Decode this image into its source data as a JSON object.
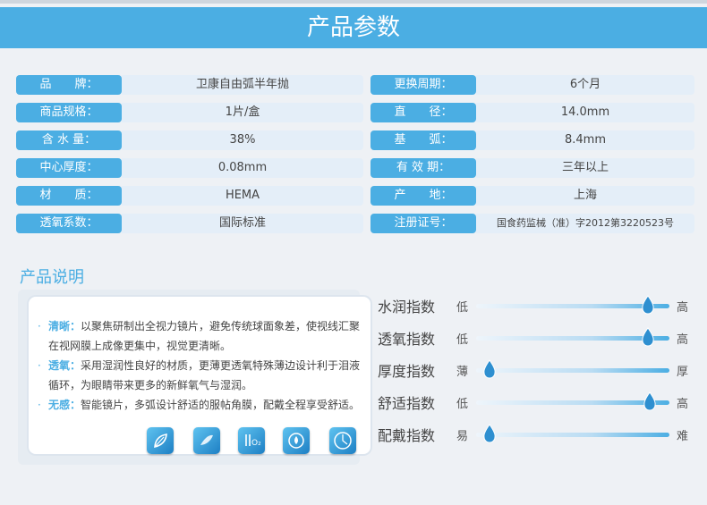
{
  "banner": {
    "title": "产品参数"
  },
  "params": [
    {
      "l_label": "品　　牌：",
      "l_value": "卫康自由弧半年抛",
      "r_label": "更换周期：",
      "r_value": "6个月"
    },
    {
      "l_label": "商品规格：",
      "l_value": "1片/盒",
      "r_label": "直　　径：",
      "r_value": "14.0mm"
    },
    {
      "l_label": "含 水 量：",
      "l_value": "38%",
      "r_label": "基　　弧：",
      "r_value": "8.4mm"
    },
    {
      "l_label": "中心厚度：",
      "l_value": "0.08mm",
      "r_label": "有 效 期：",
      "r_value": "三年以上"
    },
    {
      "l_label": "材　　质：",
      "l_value": "HEMA",
      "r_label": "产　　地：",
      "r_value": "上海"
    },
    {
      "l_label": "透氧系数：",
      "l_value": "国际标准",
      "r_label": "注册证号：",
      "r_value": "国食药监械（准）字2012第3220523号"
    }
  ],
  "description": {
    "title": "产品说明",
    "items": [
      {
        "bullet": "·",
        "head": "清晰：",
        "text": "以聚焦研制出全视力镜片，避免传统球面象差，使视线汇聚在视网膜上成像更集中，视觉更清晰。"
      },
      {
        "bullet": "·",
        "head": "透氧：",
        "text": "采用湿润性良好的材质，更薄更透氧特殊薄边设计利于泪液循环，为眼睛带来更多的新鲜氧气与湿润。"
      },
      {
        "bullet": "·",
        "head": "无感：",
        "text": "智能镜片，多弧设计舒适的服帖角膜，配戴全程享受舒适。"
      }
    ],
    "icons": [
      "lens-leaf-icon",
      "lens-shine-icon",
      "oxygen-o2-icon",
      "moisture-icon",
      "comfort-ring-icon"
    ],
    "icon_o2_text": "O₂"
  },
  "indices": [
    {
      "name": "水润指数",
      "min": "低",
      "max": "高",
      "level": 0.89
    },
    {
      "name": "透氧指数",
      "min": "低",
      "max": "高",
      "level": 0.89
    },
    {
      "name": "厚度指数",
      "min": "薄",
      "max": "厚",
      "level": 0.07
    },
    {
      "name": "舒适指数",
      "min": "低",
      "max": "高",
      "level": 0.9
    },
    {
      "name": "配戴指数",
      "min": "易",
      "max": "难",
      "level": 0.07
    }
  ],
  "colors": {
    "accent": "#4baee3",
    "value_bg": "#e4eef8"
  }
}
